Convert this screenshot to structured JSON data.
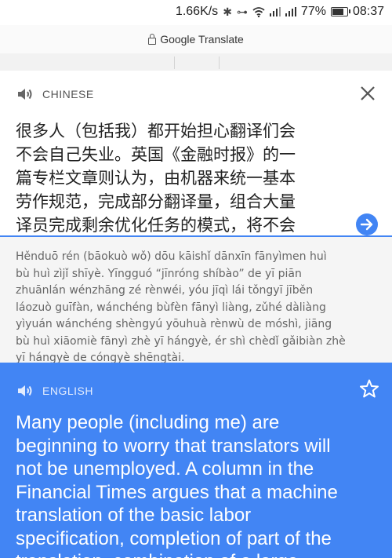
{
  "status_bar": {
    "speed": "1.66K/s",
    "battery_percent": "77%",
    "battery_level": 0.77,
    "time": "08:37"
  },
  "browser": {
    "url": "Google Translate"
  },
  "source": {
    "language": "CHINESE",
    "text": "很多人（包括我）都开始担心翻译们会\n不会自己失业。英国《金融时报》的一\n篇专栏文章则认为，由机器来统一基本\n劳作规范，完成部分翻译量，组合大量\n译员完成剩余优化任务的模式，将不会",
    "pinyin": "Hěnduō rén (bāokuò wǒ) dōu kāishǐ dānxīn fānyìmen huì\nbù huì zìjǐ shīyè. Yīngguó “jīnróng shíbào” de yī piān\nzhuānlán wénzhāng zé rènwéi, yóu jīqì lái tǒngyī jīběn\nláozuò guīfàn, wánchéng bùfèn fānyì liàng, zǔhé dàliàng\nyìyuán wánchéng shèngyú yōuhuà rènwù de móshì, jiāng\nbù huì xiāomiè fānyì zhè yī hángyè, ér shì chèdǐ gǎibiàn zhè\nyī hángyè de cóngyè shēngtài."
  },
  "result": {
    "language": "ENGLISH",
    "text": "Many people (including me) are\nbeginning to worry that translators will\nnot be unemployed. A column in the\nFinancial Times argues that a machine\ntranslation of the basic labor\nspecification, completion of part of the\ntranslation, combination of a large"
  },
  "icons": {
    "speaker": "speaker-icon",
    "close": "close-icon",
    "translate": "arrow-right-circle-icon",
    "star": "star-outline-icon",
    "lock": "lock-icon"
  },
  "colors": {
    "accent": "#4285f4",
    "pinyin_bg": "#f5f5f5"
  }
}
